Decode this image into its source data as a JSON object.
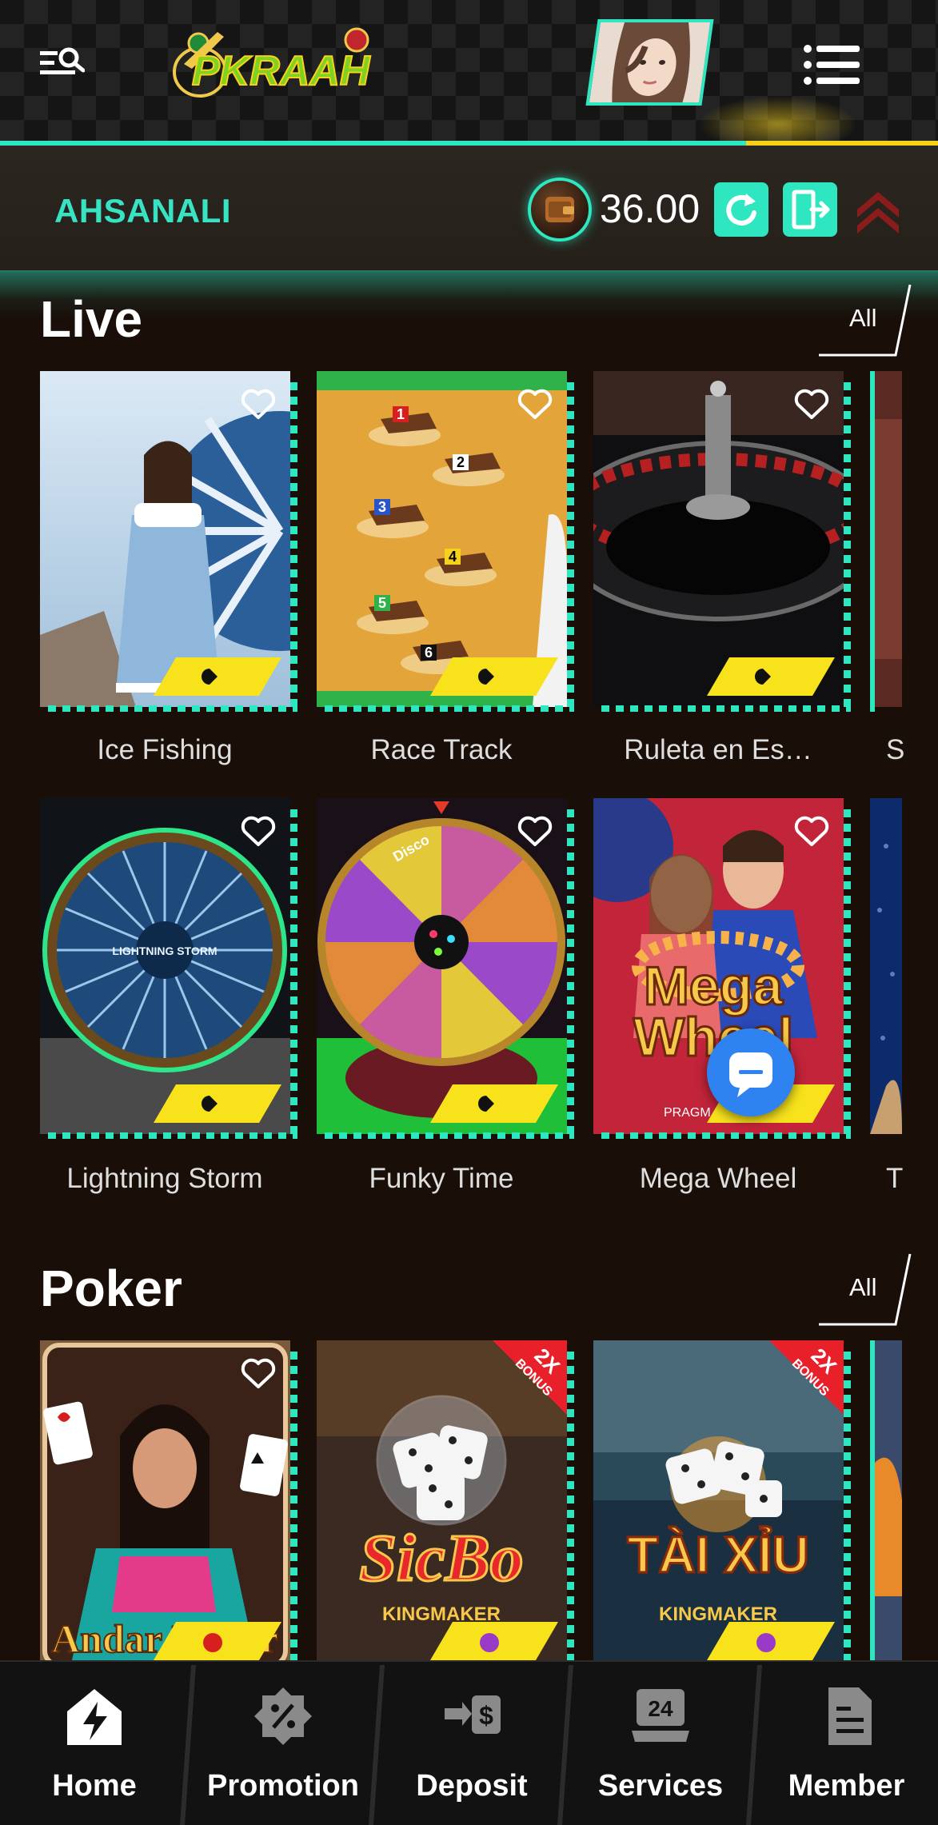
{
  "header": {
    "logo_text": "PKRAAH",
    "icons": {
      "search_menu": "search-list-icon",
      "menu": "hamburger-menu-icon"
    }
  },
  "user": {
    "username": "AHSANALI",
    "balance": "36.00"
  },
  "sections": [
    {
      "title": "Live",
      "all_label": "All",
      "rows": [
        [
          {
            "name": "Ice Fishing"
          },
          {
            "name": "Race Track"
          },
          {
            "name": "Ruleta en Es…"
          },
          {
            "name": "S"
          }
        ],
        [
          {
            "name": "Lightning Storm"
          },
          {
            "name": "Funky Time"
          },
          {
            "name": "Mega Wheel"
          },
          {
            "name": "T"
          }
        ]
      ]
    },
    {
      "title": "Poker",
      "all_label": "All",
      "rows": [
        [
          {
            "name": "Andar Bahar"
          },
          {
            "name": "SicBo",
            "badge": "2X BONUS",
            "provider": "KINGMAKER"
          },
          {
            "name": "Tài Xỉu",
            "badge": "2X BONUS",
            "provider": "KINGMAKER"
          }
        ]
      ]
    }
  ],
  "art_text": {
    "lightning_storm": "LIGHTNING STORM",
    "mega_wheel_line1": "Mega",
    "mega_wheel_line2": "Wheel",
    "mega_wheel_provider": "PRAGM",
    "sicbo_logo": "SicBo",
    "taixiu_logo": "TÀI XỈU",
    "andar_bahar_logo": "Andar Bahar",
    "kingmaker": "KINGMAKER",
    "bonus_2x": "2X",
    "bonus_word": "BONUS",
    "funky_disco": "Disco",
    "horse_numbers": [
      "1",
      "2",
      "3",
      "4",
      "5",
      "6"
    ]
  },
  "bottom_nav": [
    {
      "label": "Home",
      "icon": "lightning-house-icon"
    },
    {
      "label": "Promotion",
      "icon": "percent-tag-icon"
    },
    {
      "label": "Deposit",
      "icon": "money-transfer-icon"
    },
    {
      "label": "Services",
      "icon": "24h-support-icon"
    },
    {
      "label": "Member",
      "icon": "document-icon"
    }
  ],
  "colors": {
    "accent_teal": "#2ee6bf",
    "accent_yellow": "#f7d21b",
    "background": "#1a0e09",
    "username": "#37e3c2",
    "chat_blue": "#2f83f0"
  }
}
